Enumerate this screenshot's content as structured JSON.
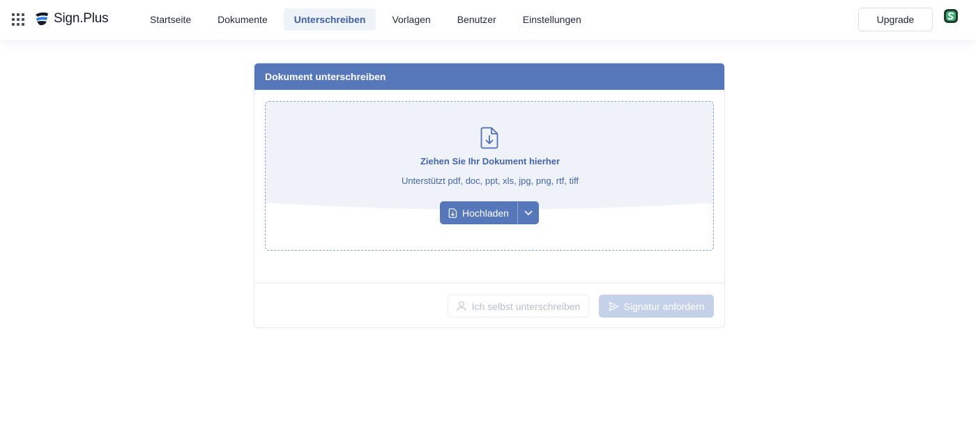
{
  "app": {
    "name": "Sign.Plus"
  },
  "nav": {
    "items": [
      {
        "label": "Startseite",
        "active": false
      },
      {
        "label": "Dokumente",
        "active": false
      },
      {
        "label": "Unterschreiben",
        "active": true
      },
      {
        "label": "Vorlagen",
        "active": false
      },
      {
        "label": "Benutzer",
        "active": false
      },
      {
        "label": "Einstellungen",
        "active": false
      }
    ],
    "upgrade_label": "Upgrade"
  },
  "card": {
    "title": "Dokument unterschreiben",
    "dropzone": {
      "title": "Ziehen Sie Ihr Dokument hierher",
      "subtitle": "Unterstützt pdf, doc, ppt, xls, jpg, png, rtf, tiff",
      "upload_label": "Hochladen"
    },
    "actions": {
      "self_sign_label": "Ich selbst unterschreiben",
      "request_label": "Signatur anfordern"
    }
  },
  "icons": {
    "apps": "apps-grid-icon",
    "file_download": "file-download-icon",
    "chevron": "chevron-down-icon",
    "user": "user-icon",
    "send": "send-icon"
  },
  "colors": {
    "primary": "#5677b9",
    "primary_text": "#4565a8",
    "nav_active_bg": "#eef2f9",
    "disabled_primary": "#c5d1e8",
    "dropzone_bg": "#eff3f9"
  }
}
